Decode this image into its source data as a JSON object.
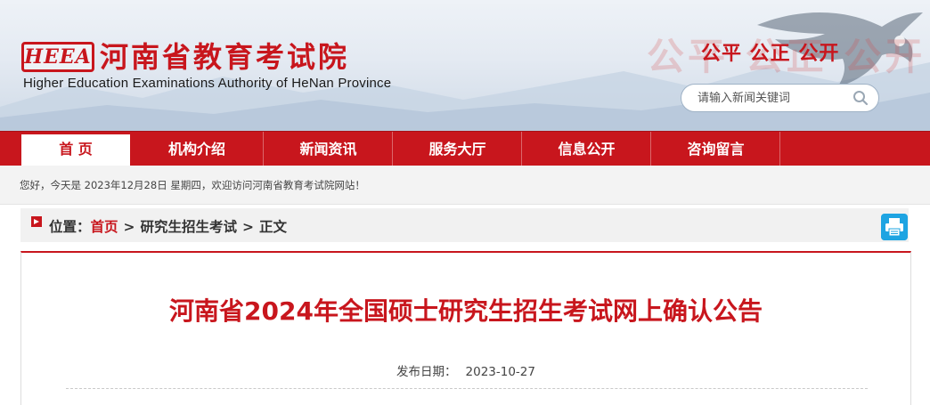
{
  "header": {
    "logo_mark": "HEEA",
    "site_name_cn": "河南省教育考试院",
    "site_name_en": "Higher Education Examinations Authority of HeNan Province",
    "slogan_ghost": "公平 公正 公开",
    "slogan": "公平 公正 公开",
    "search": {
      "placeholder": "请输入新闻关键词",
      "icon": "search-icon"
    },
    "brand_color": "#c8161d"
  },
  "nav": {
    "items": [
      {
        "label": "首 页",
        "active": true
      },
      {
        "label": "机构介绍",
        "active": false
      },
      {
        "label": "新闻资讯",
        "active": false
      },
      {
        "label": "服务大厅",
        "active": false
      },
      {
        "label": "信息公开",
        "active": false
      },
      {
        "label": "咨询留言",
        "active": false
      }
    ]
  },
  "welcome": {
    "text": "您好，今天是 2023年12月28日 星期四，欢迎访问河南省教育考试院网站！"
  },
  "breadcrumb": {
    "prefix": "位置：",
    "home": "首页",
    "section": "研究生招生考试",
    "current": "正文",
    "separator": ">"
  },
  "article": {
    "title": "河南省2024年全国硕士研究生招生考试网上确认公告",
    "date_label": "发布日期：",
    "date_value": "2023-10-27"
  },
  "icons": {
    "print": "print-icon",
    "eagle": "eagle-icon",
    "breadcrumb": "breadcrumb-arrow-icon"
  }
}
